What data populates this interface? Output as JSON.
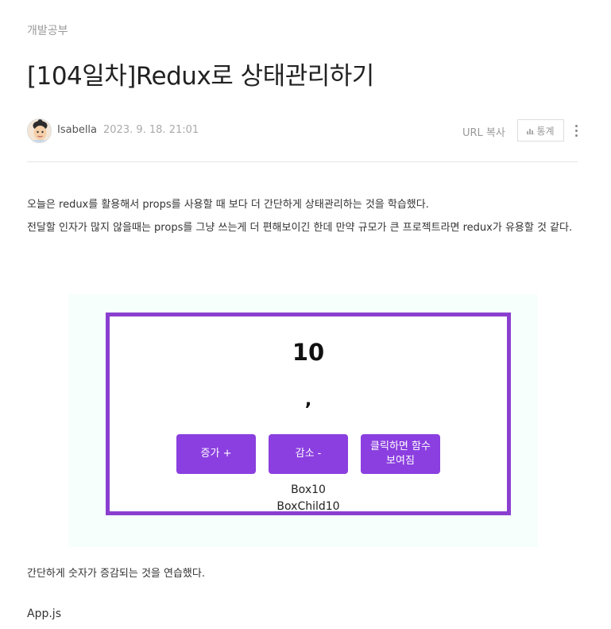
{
  "post": {
    "category": "개발공부",
    "title": "[104일차]Redux로 상태관리하기",
    "author": "Isabella",
    "date": "2023. 9. 18. 21:01",
    "url_copy_label": "URL 복사",
    "stats_label": "통계"
  },
  "body": {
    "paragraph_1": "오늘은 redux를 활용해서 props를 사용할 때 보다 더 간단하게 상태관리하는 것을 학습했다.",
    "paragraph_2": "전달할 인자가 많지 않을때는 props를 그냥 쓰는게 더 편해보이긴 한데 만약 규모가 큰 프로젝트라면 redux가 유용할 것 같다.",
    "after_image": "간단하게 숫자가 증감되는 것을 연습했다.",
    "code_file_label": "App.js"
  },
  "figure": {
    "count": "10",
    "comma": ",",
    "buttons": {
      "increment": "증가 +",
      "decrement": "감소 -",
      "show_function": "클릭하면 함수 보여짐"
    },
    "box_label": "Box10",
    "box_child_label": "BoxChild10",
    "frame_color": "#8b3fcf",
    "button_color": "#8b3fe0"
  },
  "icons": {
    "avatar": "avatar-icon",
    "stats": "bar-chart-icon",
    "more": "more-vertical-icon"
  }
}
